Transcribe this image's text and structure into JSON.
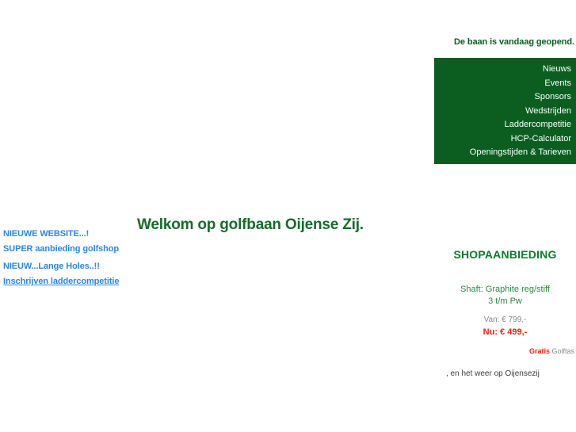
{
  "colors": {
    "green_dark": "#0b5e20",
    "green_heading": "#166b2a",
    "green_shop": "#0b7a2b",
    "green_spec": "#2a8a42",
    "link_blue": "#2a86e8",
    "red": "#ee2211",
    "grey": "#888888",
    "white": "#ffffff"
  },
  "banner": {
    "status_text": "De baan is vandaag geopend."
  },
  "nav": {
    "items": [
      {
        "label": "Nieuws"
      },
      {
        "label": "Events"
      },
      {
        "label": "Sponsors"
      },
      {
        "label": "Wedstrijden"
      },
      {
        "label": "Laddercompetitie"
      },
      {
        "label": "HCP-Calculator"
      },
      {
        "label": "Openingstijden & Tarieven"
      }
    ]
  },
  "main": {
    "welcome_heading": "Welkom op golfbaan Oijense Zij."
  },
  "left_links": {
    "items": [
      {
        "label": "NIEUWE WEBSITE...!"
      },
      {
        "label": "SUPER aanbieding golfshop"
      },
      {
        "label": "NIEUW...Lange Holes..!!"
      },
      {
        "label": "Inschrijven laddercompetitie"
      }
    ]
  },
  "shop": {
    "title": "SHOPAANBIEDING",
    "spec_line_1": "Shaft:  Graphite reg/stiff",
    "spec_line_2": "3 t/m Pw",
    "price_old": "Van: € 799,-",
    "price_new": "Nu: € 499,-",
    "free_word": "Gratis",
    "free_item": " Golftas",
    "weather_line": ", en het weer op Oijensezij"
  }
}
